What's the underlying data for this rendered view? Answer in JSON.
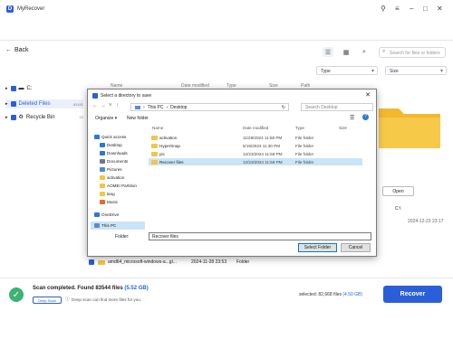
{
  "app": {
    "title": "MyRecover",
    "logo_letter": "D"
  },
  "toolbar": {
    "back_label": "Back",
    "search_placeholder": "Search for files or folders",
    "filter_type": "Type",
    "filter_size": "Size"
  },
  "sidebar": {
    "items": [
      {
        "label": "C:",
        "count": ""
      },
      {
        "label": "Deleted Files",
        "count": "83181"
      },
      {
        "label": "Recycle Bin",
        "count": "10"
      }
    ]
  },
  "columns": [
    "Name",
    "Date modified",
    "Type",
    "Size",
    "Path"
  ],
  "preview": {
    "open_label": "Open",
    "drive": "C:\\",
    "date": "2024-12-23 23:17"
  },
  "background_row": {
    "name": "amd64_microsoft-windows-a...gl...",
    "date": "2024-11-28 23:53",
    "type": "Folder"
  },
  "dialog": {
    "title": "Select a directory to save",
    "breadcrumb": [
      "This PC",
      "Desktop"
    ],
    "search_placeholder": "Search Desktop",
    "organize_label": "Organize",
    "new_folder_label": "New folder",
    "nav_items": [
      {
        "label": "Quick access",
        "color": "#2b78d6"
      },
      {
        "label": "Desktop",
        "color": "#2b78d6"
      },
      {
        "label": "Downloads",
        "color": "#2b78d6"
      },
      {
        "label": "Documents",
        "color": "#6a7a8c"
      },
      {
        "label": "Pictures",
        "color": "#4b8bd6"
      },
      {
        "label": "activation",
        "color": "#f4c542"
      },
      {
        "label": "AOMEI Partition",
        "color": "#f4c542"
      },
      {
        "label": "lang",
        "color": "#f4c542"
      },
      {
        "label": "Music",
        "color": "#e26a2c"
      },
      {
        "label": "OneDrive",
        "color": "#2b78d6"
      },
      {
        "label": "This PC",
        "color": "#5a8bd0"
      }
    ],
    "headers": [
      "Name",
      "Date modified",
      "Type",
      "Size"
    ],
    "rows": [
      {
        "name": "activation",
        "date": "11/28/2024 11:58 PM",
        "type": "File folder"
      },
      {
        "name": "HyperSnap",
        "date": "5/19/2023 11:30 PM",
        "type": "File folder"
      },
      {
        "name": "pic",
        "date": "12/23/2024 11:58 PM",
        "type": "File folder"
      },
      {
        "name": "Recover files",
        "date": "12/23/2024 11:59 PM",
        "type": "File folder"
      }
    ],
    "folder_label": "Folder:",
    "folder_value": "Recover files",
    "select_label": "Select Folder",
    "cancel_label": "Cancel"
  },
  "status": {
    "scan_text": "Scan completed. Found 83544 files",
    "scan_size": "(5.52 GB)",
    "deep_scan_label": "Deep Scan",
    "deep_scan_hint": "Deep scan can find more files for you.",
    "selected_text": "selected: 82,668 files",
    "selected_size": "(4.50 GB)",
    "recover_label": "Recover"
  },
  "colors": {
    "accent": "#2b5fd9",
    "success": "#3cb371",
    "selection": "#cce4f7"
  }
}
